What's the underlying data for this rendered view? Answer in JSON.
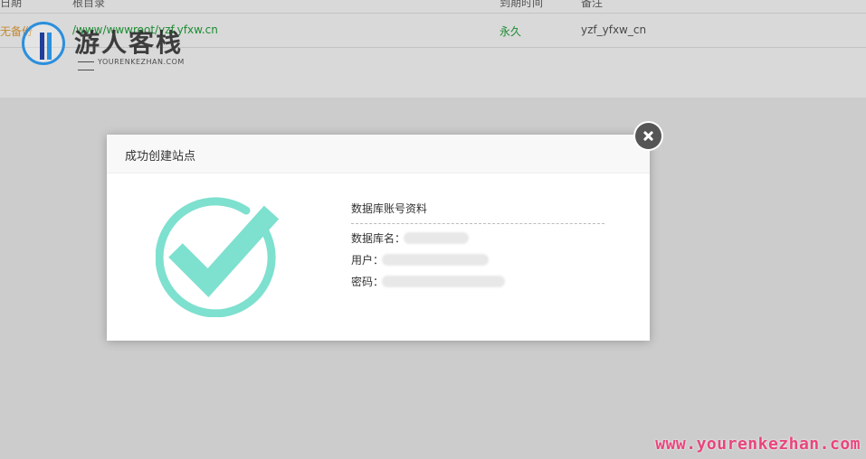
{
  "background": {
    "headers": [
      "日期",
      "根目录",
      "到期时间",
      "备注"
    ],
    "row": {
      "status": "无备份",
      "path": "/www/wwwroot/yzf.yfxw.cn",
      "expire": "永久",
      "database": "yzf_yfxw_cn"
    }
  },
  "watermark": {
    "logo_title": "游人客栈",
    "logo_subtitle": "YOURENKEZHAN.COM",
    "url": "www.yourenkezhan.com"
  },
  "modal": {
    "title": "成功创建站点",
    "success_icon": "check-circle-icon",
    "success_color": "#7ee0cf",
    "db_section_title": "数据库账号资料",
    "db_name_label": "数据库名：",
    "user_label": "用户：",
    "password_label": "密码："
  }
}
